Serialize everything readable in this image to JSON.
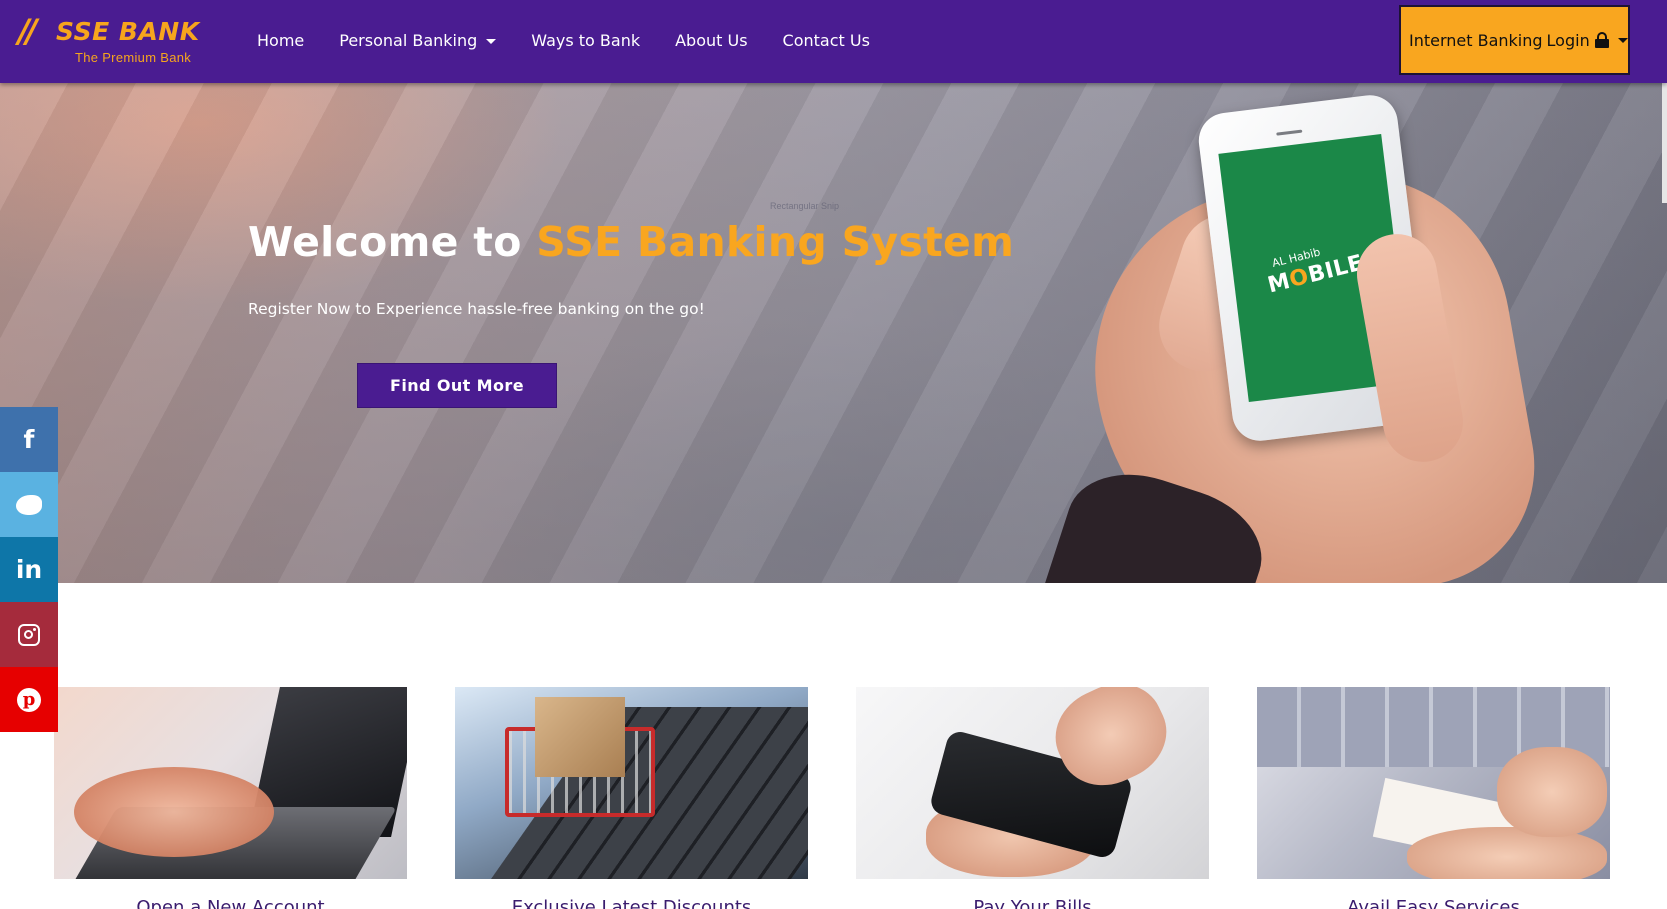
{
  "brand": {
    "slashes": "//",
    "name": "SSE BANK",
    "tagline": "The Premium Bank"
  },
  "nav": {
    "items": [
      {
        "label": "Home",
        "dropdown": false
      },
      {
        "label": "Personal Banking",
        "dropdown": true
      },
      {
        "label": "Ways to Bank",
        "dropdown": false
      },
      {
        "label": "About Us",
        "dropdown": false
      },
      {
        "label": "Contact Us",
        "dropdown": false
      }
    ],
    "login": {
      "label_main": "Internet Banking",
      "label_login": "Login",
      "icon": "lock-icon"
    }
  },
  "hero": {
    "title_prefix": "Welcome to",
    "title_accent": "SSE Banking System",
    "subtitle": "Register Now to Experience hassle-free banking on the go!",
    "cta": "Find Out More",
    "snip_watermark": "Rectangular Snip",
    "phone_app": {
      "small": "AL Habib",
      "big_pre": "M",
      "big_o": "O",
      "big_post": "BILE"
    }
  },
  "social": [
    {
      "name": "facebook",
      "icon": "facebook-icon",
      "glyph": "f",
      "color": "#3e71ac"
    },
    {
      "name": "twitter",
      "icon": "twitter-icon",
      "glyph": "",
      "color": "#5ab2e1"
    },
    {
      "name": "linkedin",
      "icon": "linkedin-icon",
      "glyph": "in",
      "color": "#0e76a8"
    },
    {
      "name": "instagram",
      "icon": "instagram-icon",
      "glyph": "",
      "color": "#a52b3c"
    },
    {
      "name": "pinterest",
      "icon": "pinterest-icon",
      "glyph": "p",
      "color": "#e60000"
    }
  ],
  "cards": [
    {
      "title": "Open a New Account"
    },
    {
      "title": "Exclusive Latest Discounts"
    },
    {
      "title": "Pay Your Bills"
    },
    {
      "title": "Avail Easy Services"
    }
  ],
  "colors": {
    "primary_purple": "#4a1c91",
    "accent_orange": "#f9a61f",
    "white": "#ffffff"
  }
}
